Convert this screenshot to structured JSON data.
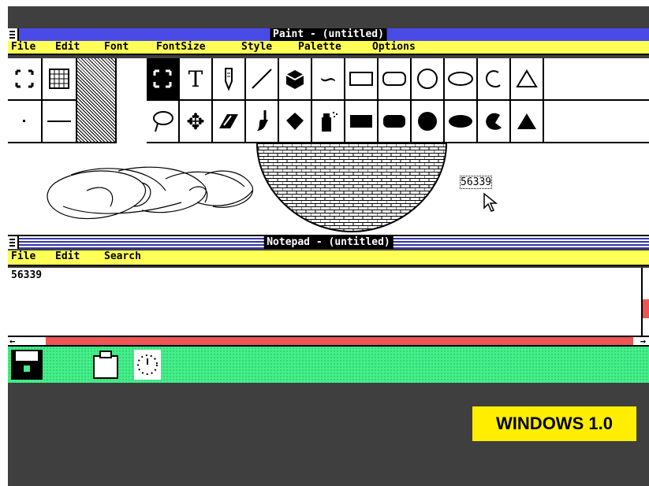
{
  "paint": {
    "title": "Paint - (untitled)",
    "menu": [
      "File",
      "Edit",
      "Font",
      "FontSize",
      "Style",
      "Palette",
      "Options"
    ],
    "tools": [
      "selection-icon",
      "text-icon",
      "pencil-icon",
      "line-icon",
      "cube-icon",
      "curve-icon",
      "rectangle-icon",
      "rounded-rect-icon",
      "circle-icon",
      "ellipse-icon",
      "freeform-icon",
      "polygon-icon",
      "lasso-icon",
      "move-icon",
      "eraser-icon",
      "brush-icon",
      "fill-icon",
      "spraycan-icon"
    ],
    "canvas_text": "56339"
  },
  "notepad": {
    "title": "Notepad - (untitled)",
    "menu": [
      "File",
      "Edit",
      "Search"
    ],
    "content": "56339"
  },
  "badge": "WINDOWS 1.0"
}
